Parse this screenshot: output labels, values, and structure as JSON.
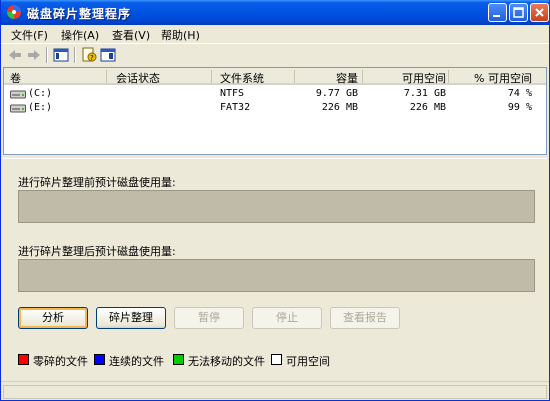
{
  "window": {
    "title": "磁盘碎片整理程序"
  },
  "menu": [
    {
      "label": "文件(F)"
    },
    {
      "label": "操作(A)"
    },
    {
      "label": "查看(V)"
    },
    {
      "label": "帮助(H)"
    }
  ],
  "columns": [
    "卷",
    "会话状态",
    "文件系统",
    "容量",
    "可用空间",
    "% 可用空间"
  ],
  "volumes": [
    {
      "name": "(C:)",
      "status": "",
      "fs": "NTFS",
      "capacity": "9.77 GB",
      "free": "7.31 GB",
      "pct": "74 %"
    },
    {
      "name": "(E:)",
      "status": "",
      "fs": "FAT32",
      "capacity": "226 MB",
      "free": "226 MB",
      "pct": "99 %"
    }
  ],
  "labels": {
    "before": "进行碎片整理前预计磁盘使用量:",
    "after": "进行碎片整理后预计磁盘使用量:"
  },
  "buttons": {
    "analyze": "分析",
    "defrag": "碎片整理",
    "pause": "暂停",
    "stop": "停止",
    "report": "查看报告"
  },
  "legend": [
    {
      "label": "零碎的文件",
      "color": "#ff0000"
    },
    {
      "label": "连续的文件",
      "color": "#0000ff"
    },
    {
      "label": "无法移动的文件",
      "color": "#00cc00"
    },
    {
      "label": "可用空间",
      "color": "#ffffff"
    }
  ]
}
